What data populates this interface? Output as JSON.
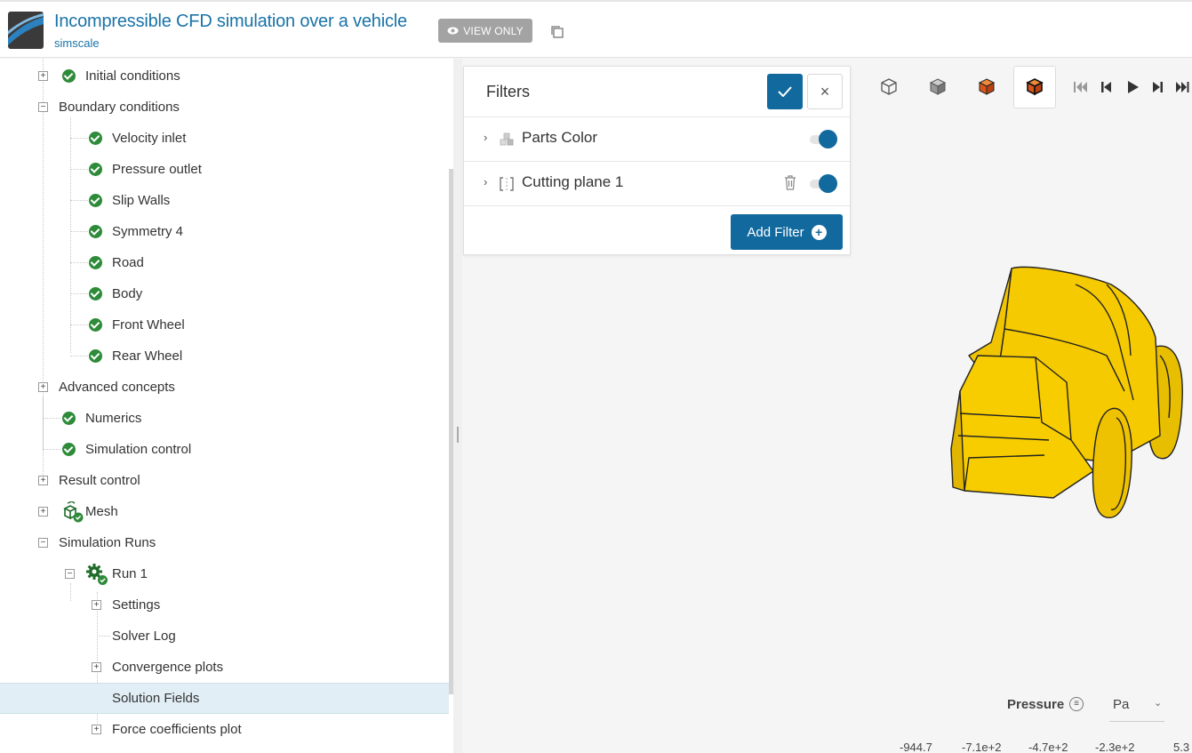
{
  "header": {
    "title": "Incompressible CFD simulation over a vehicle",
    "owner": "simscale",
    "view_only": "VIEW ONLY"
  },
  "tree": {
    "items": [
      {
        "label": "Initial conditions",
        "status": "done"
      },
      {
        "label": "Boundary conditions",
        "expanded": true
      },
      {
        "label": "Velocity inlet",
        "status": "done"
      },
      {
        "label": "Pressure outlet",
        "status": "done"
      },
      {
        "label": "Slip Walls",
        "status": "done"
      },
      {
        "label": "Symmetry 4",
        "status": "done"
      },
      {
        "label": "Road",
        "status": "done"
      },
      {
        "label": "Body",
        "status": "done"
      },
      {
        "label": "Front Wheel",
        "status": "done"
      },
      {
        "label": "Rear Wheel",
        "status": "done"
      },
      {
        "label": "Advanced concepts",
        "expanded": false
      },
      {
        "label": "Numerics",
        "status": "done"
      },
      {
        "label": "Simulation control",
        "status": "done"
      },
      {
        "label": "Result control",
        "expanded": false
      },
      {
        "label": "Mesh",
        "expanded": false,
        "icon": "mesh-icon"
      },
      {
        "label": "Simulation Runs",
        "expanded": true
      },
      {
        "label": "Run 1",
        "expanded": true,
        "icon": "gear-icon"
      },
      {
        "label": "Settings",
        "expanded": false
      },
      {
        "label": "Solver Log"
      },
      {
        "label": "Convergence plots",
        "expanded": false
      },
      {
        "label": "Solution Fields",
        "selected": true
      },
      {
        "label": "Force coefficients plot",
        "expanded": false
      }
    ]
  },
  "filters": {
    "title": "Filters",
    "items": [
      {
        "label": "Parts Color",
        "enabled": true,
        "icon": "cubes-icon"
      },
      {
        "label": "Cutting plane 1",
        "enabled": true,
        "icon": "cutting-plane-icon"
      }
    ],
    "add_label": "Add Filter"
  },
  "legend": {
    "label": "Pressure",
    "unit": "Pa",
    "ticks": [
      "-944.7",
      "-7.1e+2",
      "-4.7e+2",
      "-2.3e+2",
      "5.3"
    ]
  },
  "colors": {
    "accent": "#11699e",
    "title": "#1a73a8",
    "success": "#2e8b3a",
    "model": "#f2c500",
    "selected_row": "#e2eef6"
  }
}
